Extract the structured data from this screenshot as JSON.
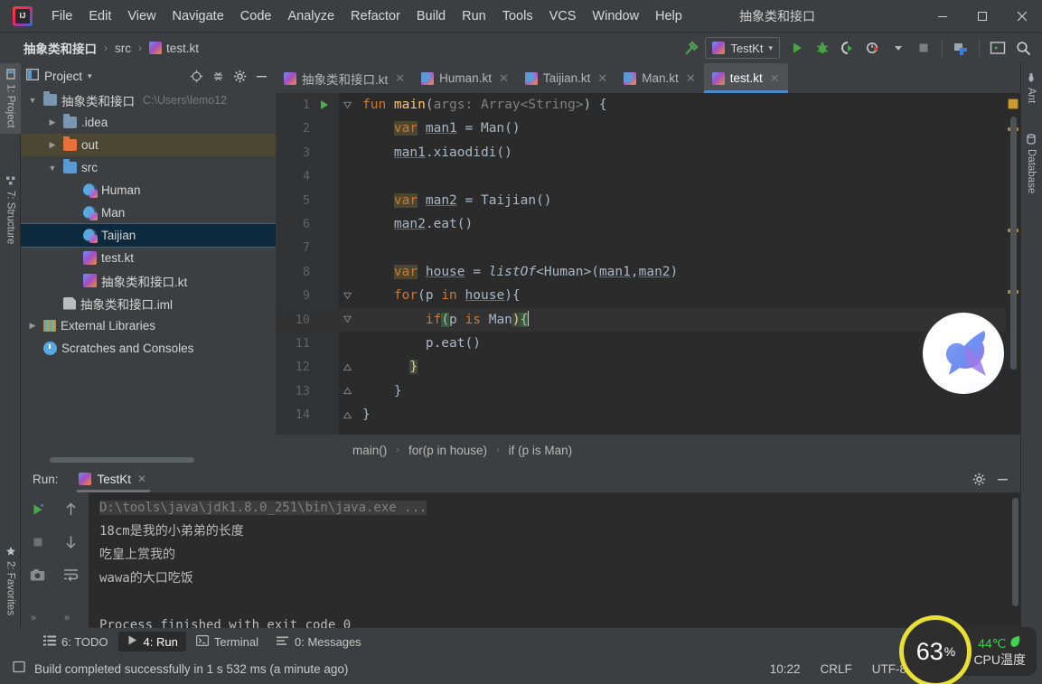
{
  "window": {
    "title": "抽象类和接口",
    "minimize": "—",
    "maximize": "▢",
    "close": "✕"
  },
  "menu": {
    "items": [
      "File",
      "Edit",
      "View",
      "Navigate",
      "Code",
      "Analyze",
      "Refactor",
      "Build",
      "Run",
      "Tools",
      "VCS",
      "Window",
      "Help"
    ]
  },
  "navbar": {
    "crumbs": [
      "抽象类和接口",
      "src",
      "test.kt"
    ],
    "separator": "›",
    "run_config": "TestKt",
    "dropdown_caret": "▾"
  },
  "toolbar": {
    "build_icon": "hammer-icon",
    "run_icon": "run-icon",
    "debug_icon": "debug-icon",
    "run_coverage_icon": "run-with-coverage-icon",
    "profiler_icon": "profiler-icon",
    "stop_icon": "stop-icon",
    "update_icon": "update-project-icon",
    "terminal_icon": "open-terminal-icon",
    "search_icon": "search-everywhere-icon"
  },
  "left_strip": {
    "tabs": [
      {
        "label": "1: Project",
        "icon": "project-icon",
        "active": true
      },
      {
        "label": "7: Structure",
        "icon": "structure-icon",
        "active": false
      },
      {
        "label": "2: Favorites",
        "icon": "star-icon",
        "active": false
      }
    ]
  },
  "right_strip": {
    "tabs": [
      {
        "label": "Ant",
        "icon": "ant-icon"
      },
      {
        "label": "Database",
        "icon": "database-icon"
      }
    ]
  },
  "project_panel": {
    "title": "Project",
    "caret": "▾",
    "actions": [
      "locate-icon",
      "collapse-all-icon",
      "settings-gear-icon",
      "hide-icon"
    ],
    "tree": [
      {
        "label": "抽象类和接口",
        "path": "C:\\Users\\lemo12",
        "arrow": "▼",
        "indent": 0,
        "icon": "project-folder-icon",
        "state": "normal"
      },
      {
        "label": ".idea",
        "path": "",
        "arrow": "▶",
        "indent": 1,
        "icon": "folder-icon",
        "state": "normal"
      },
      {
        "label": "out",
        "path": "",
        "arrow": "▶",
        "indent": 1,
        "icon": "folder-orange-icon",
        "state": "out"
      },
      {
        "label": "src",
        "path": "",
        "arrow": "▼",
        "indent": 1,
        "icon": "folder-src-icon",
        "state": "normal"
      },
      {
        "label": "Human",
        "path": "",
        "arrow": "",
        "indent": 2,
        "icon": "kotlin-class-icon",
        "state": "normal"
      },
      {
        "label": "Man",
        "path": "",
        "arrow": "",
        "indent": 2,
        "icon": "kotlin-class-icon",
        "state": "normal"
      },
      {
        "label": "Taijian",
        "path": "",
        "arrow": "",
        "indent": 2,
        "icon": "kotlin-class-icon",
        "state": "selected"
      },
      {
        "label": "test.kt",
        "path": "",
        "arrow": "",
        "indent": 2,
        "icon": "kotlin-file-icon",
        "state": "normal"
      },
      {
        "label": "抽象类和接口.kt",
        "path": "",
        "arrow": "",
        "indent": 2,
        "icon": "kotlin-file-icon",
        "state": "normal"
      },
      {
        "label": "抽象类和接口.iml",
        "path": "",
        "arrow": "",
        "indent": 1,
        "icon": "iml-file-icon",
        "state": "normal"
      },
      {
        "label": "External Libraries",
        "path": "",
        "arrow": "▶",
        "indent": 0,
        "icon": "libraries-icon",
        "state": "normal"
      },
      {
        "label": "Scratches and Consoles",
        "path": "",
        "arrow": "",
        "indent": 0,
        "icon": "scratches-icon",
        "state": "normal"
      }
    ]
  },
  "editor": {
    "tabs": [
      {
        "label": "抽象类和接口.kt",
        "close": "✕",
        "active": false
      },
      {
        "label": "Human.kt",
        "close": "✕",
        "active": false
      },
      {
        "label": "Taijian.kt",
        "close": "✕",
        "active": false
      },
      {
        "label": "Man.kt",
        "close": "✕",
        "active": false
      },
      {
        "label": "test.kt",
        "close": "✕",
        "active": true
      }
    ],
    "lines": [
      {
        "n": "1",
        "current": false
      },
      {
        "n": "2",
        "current": false
      },
      {
        "n": "3",
        "current": false
      },
      {
        "n": "4",
        "current": false
      },
      {
        "n": "5",
        "current": false
      },
      {
        "n": "6",
        "current": false
      },
      {
        "n": "7",
        "current": false
      },
      {
        "n": "8",
        "current": false
      },
      {
        "n": "9",
        "current": false
      },
      {
        "n": "10",
        "current": true
      },
      {
        "n": "11",
        "current": false
      },
      {
        "n": "12",
        "current": false
      },
      {
        "n": "13",
        "current": false
      },
      {
        "n": "14",
        "current": false
      }
    ],
    "source_text": [
      "fun main(args: Array<String>) {",
      "    var man1 = Man()",
      "    man1.xiaodidi()",
      "",
      "    var man2 = Taijian()",
      "    man2.eat()",
      "",
      "    var house = listOf<Human>(man1,man2)",
      "    for(p in house){",
      "        if(p is Man){",
      "        p.eat()",
      "      }",
      "    }",
      "}"
    ],
    "breadcrumbs": [
      "main()",
      "for(p in house)",
      "if (p is Man)"
    ],
    "breadcrumb_sep": "›",
    "watermark_icon": "bird-logo"
  },
  "run_panel": {
    "label": "Run:",
    "tab": "TestKt",
    "tab_close": "✕",
    "header_actions": [
      "settings-gear-icon",
      "hide-icon"
    ],
    "toolbar_left": [
      "rerun-icon",
      "stop-icon",
      "screenshot-icon",
      "expand-more-icon"
    ],
    "toolbar_right": [
      "scroll-up-icon",
      "scroll-down-icon",
      "soft-wrap-icon",
      "expand-more-icon"
    ],
    "console": [
      {
        "text": "D:\\tools\\java\\jdk1.8.0_251\\bin\\java.exe ...",
        "dim": true
      },
      {
        "text": "18cm是我的小弟弟的长度",
        "dim": false
      },
      {
        "text": "吃皇上赏我的",
        "dim": false
      },
      {
        "text": "wawa的大口吃饭",
        "dim": false
      },
      {
        "text": "",
        "dim": false
      },
      {
        "text": "Process finished with exit code 0",
        "dim": false
      }
    ]
  },
  "toolwindow_bar": {
    "items": [
      {
        "label": "6: TODO",
        "icon": "todo-icon",
        "active": false
      },
      {
        "label": "4: Run",
        "icon": "run-icon",
        "active": true
      },
      {
        "label": "Terminal",
        "icon": "terminal-icon",
        "active": false
      },
      {
        "label": "0: Messages",
        "icon": "messages-icon",
        "active": false
      }
    ]
  },
  "status_bar": {
    "icon": "build-status-icon",
    "message": "Build completed successfully in 1 s 532 ms (a minute ago)",
    "position": "10:22",
    "line_separator": "CRLF",
    "encoding": "UTF-8"
  },
  "cpu_widget": {
    "percent": "63",
    "percent_symbol": "%",
    "temperature": "44℃",
    "leaf_icon": "leaf-icon",
    "label": "CPU温度",
    "ring_color": "#e9e035",
    "temp_color": "#3bd44a"
  }
}
